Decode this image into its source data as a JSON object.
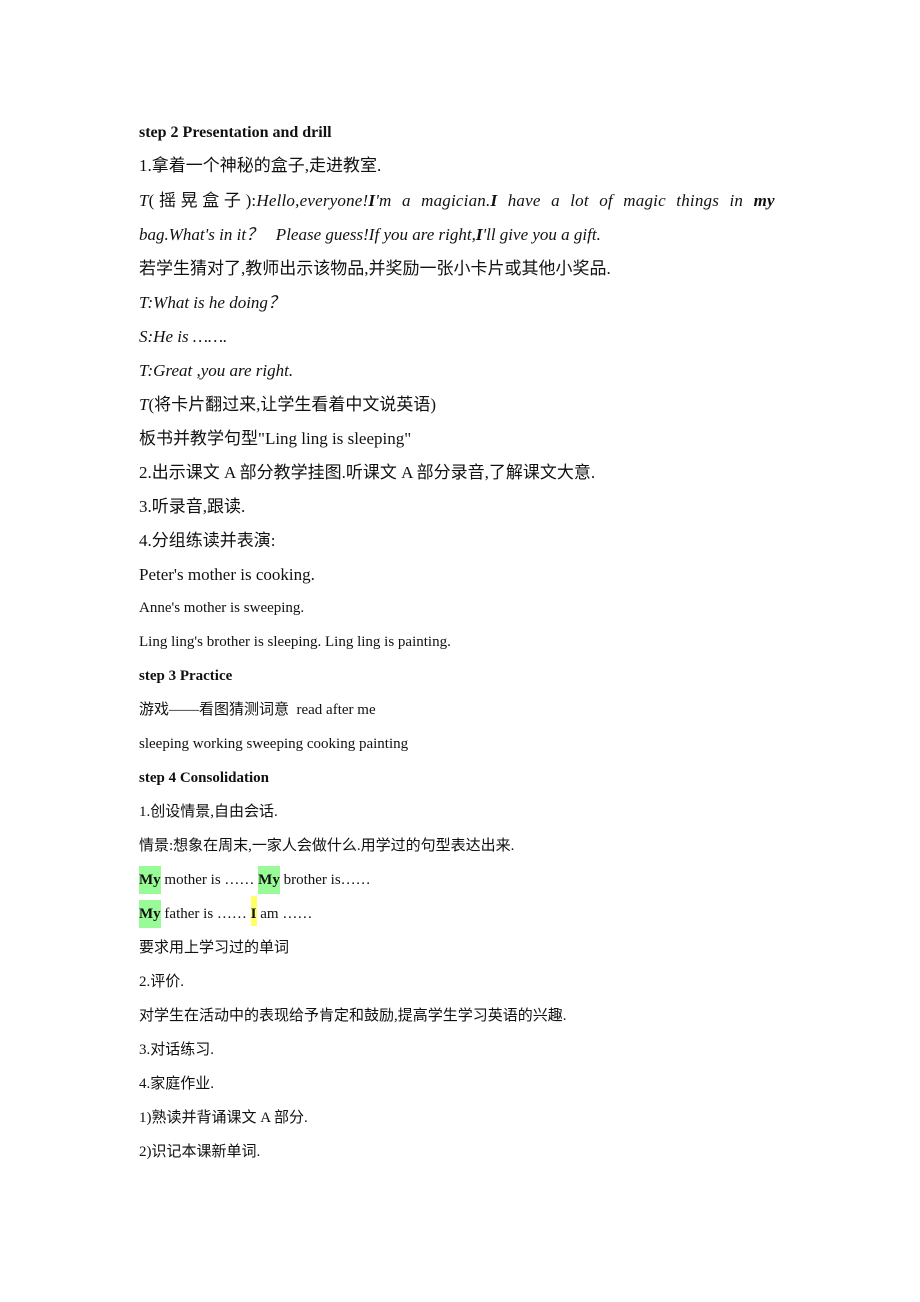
{
  "document": {
    "step2": {
      "heading": "step 2 Presentation and drill",
      "item1": "1.拿着一个神秘的盒子,走进教室.",
      "teacher_line1": {
        "t": "T",
        "paren": "( 摇 晃 盒 子 ):",
        "part1": "Hello,everyone!",
        "bold1": "I",
        "part2": "'m  a  magician.",
        "bold2": "I",
        "part3": " have  a  lot  of  magic  things  in ",
        "bold3": "my"
      },
      "teacher_line2": {
        "part1": "bag.What's in it？   Please guess!If you are right,",
        "bold1": "I",
        "part2": "'ll give you a gift."
      },
      "note": "若学生猜对了,教师出示该物品,并奖励一张小卡片或其他小奖品.",
      "dialog1": "T:What is he doing？",
      "dialog2": "S:He is …….",
      "dialog3": "T:Great ,you are right.",
      "dialog4_t": "T",
      "dialog4_rest": "(将卡片翻过来,让学生看着中文说英语)",
      "board": "板书并教学句型\"Ling ling is sleeping\"",
      "item2": "2.出示课文 A 部分教学挂图.听课文 A 部分录音,了解课文大意.",
      "item3": "3.听录音,跟读.",
      "item4": "4.分组练读并表演:",
      "sentence1": "Peter's mother is cooking.",
      "sentence2": "Anne's mother is sweeping.",
      "sentence3": "Ling ling's brother is sleeping. Ling ling is painting."
    },
    "step3": {
      "heading": "step 3 Practice",
      "game": "游戏——看图猜测词意  read after me",
      "words": "sleeping working sweeping cooking painting"
    },
    "step4": {
      "heading": "step 4 Consolidation",
      "item1": "1.创设情景,自由会话.",
      "scene": "情景:想象在周末,一家人会做什么.用学过的句型表达出来.",
      "pattern_row1": {
        "my1": "My",
        "text1": " mother is …… ",
        "my2": "My",
        "text2": " brother is……"
      },
      "pattern_row2": {
        "my1": "My",
        "text1": " father is …… ",
        "i": "I",
        "text2": " am ……"
      },
      "requirement": "要求用上学习过的单词",
      "item2": "2.评价.",
      "evaluation": "对学生在活动中的表现给予肯定和鼓励,提高学生学习英语的兴趣.",
      "item3": "3.对话练习.",
      "item4": "4.家庭作业.",
      "hw1": "1)熟读并背诵课文 A 部分.",
      "hw2": "2)识记本课新单词."
    },
    "highlight_colors": {
      "green": "#98fb98",
      "yellow": "#ffff66"
    }
  }
}
